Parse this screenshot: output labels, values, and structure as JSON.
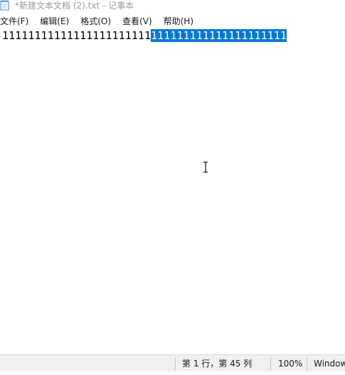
{
  "window": {
    "title": "*新建文本文档 (2).txt - 记事本"
  },
  "menu": [
    {
      "label": "文件(F)"
    },
    {
      "label": "编辑(E)"
    },
    {
      "label": "格式(O)"
    },
    {
      "label": "查看(V)"
    },
    {
      "label": "帮助(H)"
    }
  ],
  "editor": {
    "unselected_text": "11111111111111111111111",
    "selected_text": "111111111111111111111"
  },
  "status": {
    "position": "第 1 行，第 45 列",
    "zoom": "100%",
    "line_ending": "Windows (CRLF)"
  },
  "colors": {
    "selection": "#0078d7",
    "statusbar_bg": "#f0f0f0"
  },
  "icons": {
    "app_icon": "notepad-icon",
    "cursor": "text-ibeam-cursor"
  }
}
